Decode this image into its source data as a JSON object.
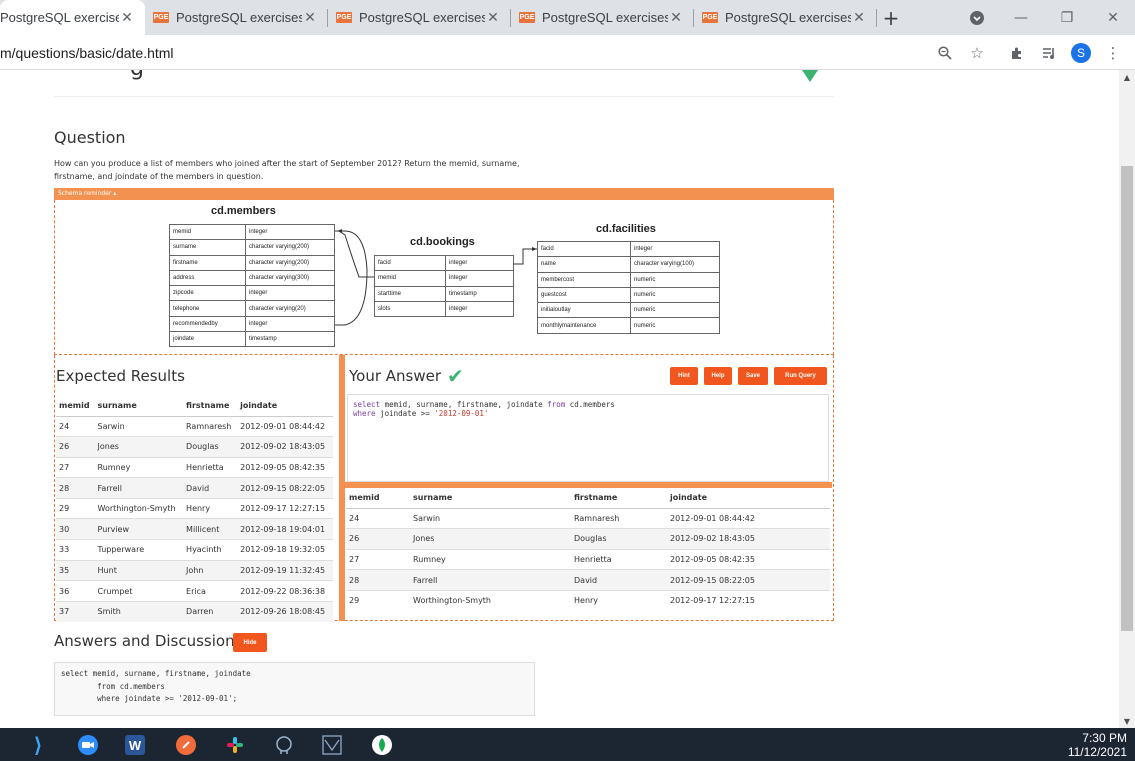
{
  "browser": {
    "tabs": [
      {
        "title": "PostgreSQL exercises",
        "active": true
      },
      {
        "title": "PostgreSQL exercises",
        "active": false
      },
      {
        "title": "PostgreSQL exercises",
        "active": false
      },
      {
        "title": "PostgreSQL exercises",
        "active": false
      },
      {
        "title": "PostgreSQL exercises",
        "active": false
      }
    ],
    "favicon_text": "PGE",
    "url": "m/questions/basic/date.html",
    "profile_initial": "S"
  },
  "page": {
    "partial_heading": "g",
    "question_heading": "Question",
    "question_text": "How can you produce a list of members who joined after the start of September 2012? Return the memid, surname, firstname, and joindate of the members in question.",
    "schema_reminder": "Schema reminder ▴",
    "schema": {
      "members": {
        "title": "cd.members",
        "rows": [
          [
            "memid",
            "integer"
          ],
          [
            "surname",
            "character varying(200)"
          ],
          [
            "firstname",
            "character varying(200)"
          ],
          [
            "address",
            "character varying(300)"
          ],
          [
            "zipcode",
            "integer"
          ],
          [
            "telephone",
            "character varying(20)"
          ],
          [
            "recommendedby",
            "integer"
          ],
          [
            "joindate",
            "timestamp"
          ]
        ]
      },
      "bookings": {
        "title": "cd.bookings",
        "rows": [
          [
            "facid",
            "integer"
          ],
          [
            "memid",
            "integer"
          ],
          [
            "starttime",
            "timestamp"
          ],
          [
            "slots",
            "integer"
          ]
        ]
      },
      "facilities": {
        "title": "cd.facilities",
        "rows": [
          [
            "facid",
            "integer"
          ],
          [
            "name",
            "character varying(100)"
          ],
          [
            "membercost",
            "numeric"
          ],
          [
            "guestcost",
            "numeric"
          ],
          [
            "initialoutlay",
            "numeric"
          ],
          [
            "monthlymaintenance",
            "numeric"
          ]
        ]
      }
    },
    "expected": {
      "heading": "Expected Results",
      "columns": [
        "memid",
        "surname",
        "firstname",
        "joindate"
      ],
      "rows": [
        [
          "24",
          "Sarwin",
          "Ramnaresh",
          "2012-09-01 08:44:42"
        ],
        [
          "26",
          "Jones",
          "Douglas",
          "2012-09-02 18:43:05"
        ],
        [
          "27",
          "Rumney",
          "Henrietta",
          "2012-09-05 08:42:35"
        ],
        [
          "28",
          "Farrell",
          "David",
          "2012-09-15 08:22:05"
        ],
        [
          "29",
          "Worthington-Smyth",
          "Henry",
          "2012-09-17 12:27:15"
        ],
        [
          "30",
          "Purview",
          "Millicent",
          "2012-09-18 19:04:01"
        ],
        [
          "33",
          "Tupperware",
          "Hyacinth",
          "2012-09-18 19:32:05"
        ],
        [
          "35",
          "Hunt",
          "John",
          "2012-09-19 11:32:45"
        ],
        [
          "36",
          "Crumpet",
          "Erica",
          "2012-09-22 08:36:38"
        ],
        [
          "37",
          "Smith",
          "Darren",
          "2012-09-26 18:08:45"
        ]
      ]
    },
    "answer": {
      "heading": "Your Answer",
      "check": "✔",
      "buttons": [
        "Hint",
        "Help",
        "Save",
        "Run Query"
      ],
      "query_line1_kw1": "select",
      "query_line1_mid": " memid, surname, firstname, joindate ",
      "query_line1_kw2": "from",
      "query_line1_end": " cd.members",
      "query_line2_kw": "where",
      "query_line2_mid": " joindate >= ",
      "query_line2_str": "'2012-09-01'",
      "columns": [
        "memid",
        "surname",
        "firstname",
        "joindate"
      ],
      "rows": [
        [
          "24",
          "Sarwin",
          "Ramnaresh",
          "2012-09-01 08:44:42"
        ],
        [
          "26",
          "Jones",
          "Douglas",
          "2012-09-02 18:43:05"
        ],
        [
          "27",
          "Rumney",
          "Henrietta",
          "2012-09-05 08:42:35"
        ],
        [
          "28",
          "Farrell",
          "David",
          "2012-09-15 08:22:05"
        ],
        [
          "29",
          "Worthington-Smyth",
          "Henry",
          "2012-09-17 12:27:15"
        ]
      ]
    },
    "discussion": {
      "heading": "Answers and Discussion",
      "hide_label": "Hide",
      "code_line1": "select memid, surname, firstname, joindate",
      "code_line2": "        from cd.members",
      "code_line3": "        where joindate >= '2012-09-01';"
    }
  },
  "taskbar": {
    "apps": [
      "vscode-icon",
      "zoom-icon",
      "word-icon",
      "postman-icon",
      "slack-icon",
      "pgadmin-icon",
      "azure-data-icon",
      "mongodb-icon"
    ],
    "word_letter": "W",
    "time": "7:30 PM",
    "date": "11/12/2021"
  }
}
